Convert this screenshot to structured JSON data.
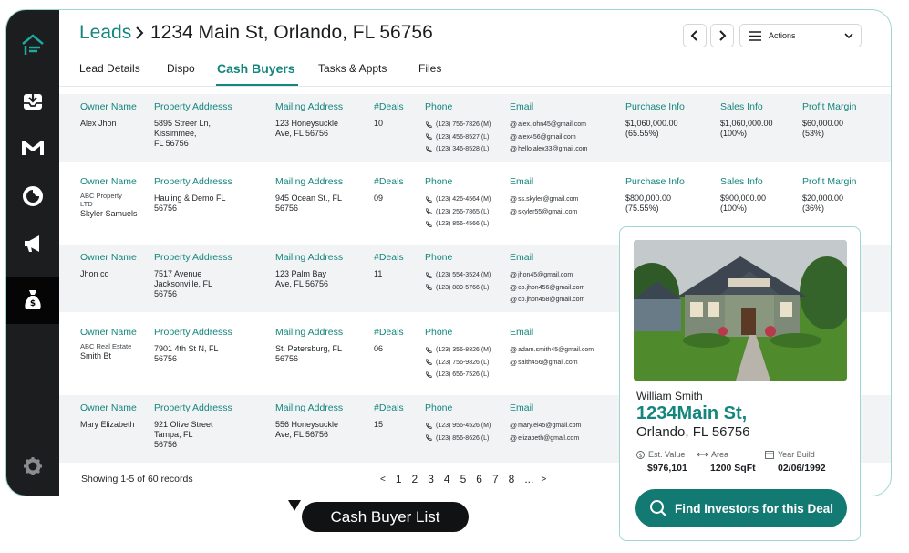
{
  "breadcrumb": {
    "section": "Leads",
    "address": "1234 Main St, Orlando, FL 56756"
  },
  "header": {
    "actions_label": "Actions"
  },
  "sidebar": {
    "items": [
      {
        "icon": "logo-icon"
      },
      {
        "icon": "inbox-icon"
      },
      {
        "icon": "gmail-icon"
      },
      {
        "icon": "analytics-icon"
      },
      {
        "icon": "megaphone-icon"
      },
      {
        "icon": "investor-icon",
        "active": true
      },
      {
        "icon": "gear-icon"
      }
    ]
  },
  "tabs": [
    "Lead Details",
    "Dispo",
    "Cash Buyers",
    "Tasks & Appts",
    "Files"
  ],
  "active_tab": "Cash Buyers",
  "columns": {
    "owner": "Owner Name",
    "property": "Property Addresss",
    "mailing": "Mailing Address",
    "deals": "#Deals",
    "phone": "Phone",
    "email": "Email",
    "purchase": "Purchase Info",
    "sales": "Sales Info",
    "profit": "Profit Margin"
  },
  "rows": [
    {
      "company": "",
      "owner": "Alex Jhon",
      "property": "5895 Streer Ln,\nKissimmee,\nFL 56756",
      "mailing": "123 Honeysuckle\nAve, FL 56756",
      "deals": "10",
      "phones": [
        "(123) 756-7826 (M)",
        "(123) 456-8527 (L)",
        "(123) 346-8528 (L)"
      ],
      "emails": [
        "alex.john45@gmail.com",
        "alex456@gmail.com",
        "hello.alex33@gmail.com"
      ],
      "purchase": "$1,060,000.00\n(65.55%)",
      "sales": "$1,060,000.00\n(100%)",
      "profit": "$60,000.00\n(53%)"
    },
    {
      "company": "ABC Property\nLTD",
      "owner": "Skyler Samuels",
      "property": "Hauling & Demo FL\n56756",
      "mailing": "945 Ocean St., FL\n56756",
      "deals": "09",
      "phones": [
        "(123) 426-4564 (M)",
        "(123) 256-7865 (L)",
        "(123) 856-4566 (L)"
      ],
      "emails": [
        "ss.skyler@gmail.com",
        "skyler55@gmail.com"
      ],
      "purchase": "$800,000.00\n(75.55%)",
      "sales": "$900,000.00\n(100%)",
      "profit": "$20,000.00\n(36%)"
    },
    {
      "company": "",
      "owner": "Jhon co",
      "property": "7517 Avenue\nJacksonville, FL\n56756",
      "mailing": "123 Palm Bay\nAve, FL 56756",
      "deals": "11",
      "phones": [
        "(123) 554-3524 (M)",
        "(123) 889-5766 (L)"
      ],
      "emails": [
        "jhon45@gmail.com",
        "co.jhon456@gmail.com",
        "co.jhon458@gmail.com"
      ],
      "purchase": "",
      "sales": "",
      "profit": ""
    },
    {
      "company": "ABC Real Estate",
      "owner": "Smith Bt",
      "property": "7901 4th St N, FL\n56756",
      "mailing": "St. Petersburg, FL\n56756",
      "deals": "06",
      "phones": [
        "(123) 356-8826 (M)",
        "(123) 756-9826 (L)",
        "(123) 656-7526 (L)"
      ],
      "emails": [
        "adam.smith45@gmail.com",
        "saith456@gmail.com"
      ],
      "purchase": "",
      "sales": "",
      "profit": ""
    },
    {
      "company": "",
      "owner": "Mary Elizabeth",
      "property": "921 Olive Street\nTampa, FL\n56756",
      "mailing": "556 Honeysuckle\nAve, FL 56756",
      "deals": "15",
      "phones": [
        "(123) 956-4526 (M)",
        "(123) 856-8626 (L)"
      ],
      "emails": [
        "mary.el45@gmail.com",
        "elizabeth@gmail.com"
      ],
      "purchase": "",
      "sales": "",
      "profit": ""
    }
  ],
  "footer": {
    "records": "Showing 1-5 of 60 records",
    "pages": [
      "1",
      "2",
      "3",
      "4",
      "5",
      "6",
      "7",
      "8",
      "..."
    ],
    "prev": "<",
    "next": ">"
  },
  "property_card": {
    "owner": "William Smith",
    "street": "1234Main St,",
    "city": "Orlando, FL 56756",
    "est_value_label": "Est. Value",
    "est_value": "$976,101",
    "area_label": "Area",
    "area": "1200 SqFt",
    "year_label": "Year Build",
    "year": "02/06/1992",
    "cta": "Find Investors for this Deal"
  },
  "tooltip": "Cash Buyer List",
  "colors": {
    "accent": "#14867d",
    "sidebar": "#1c1d1f",
    "button": "#127a72"
  }
}
